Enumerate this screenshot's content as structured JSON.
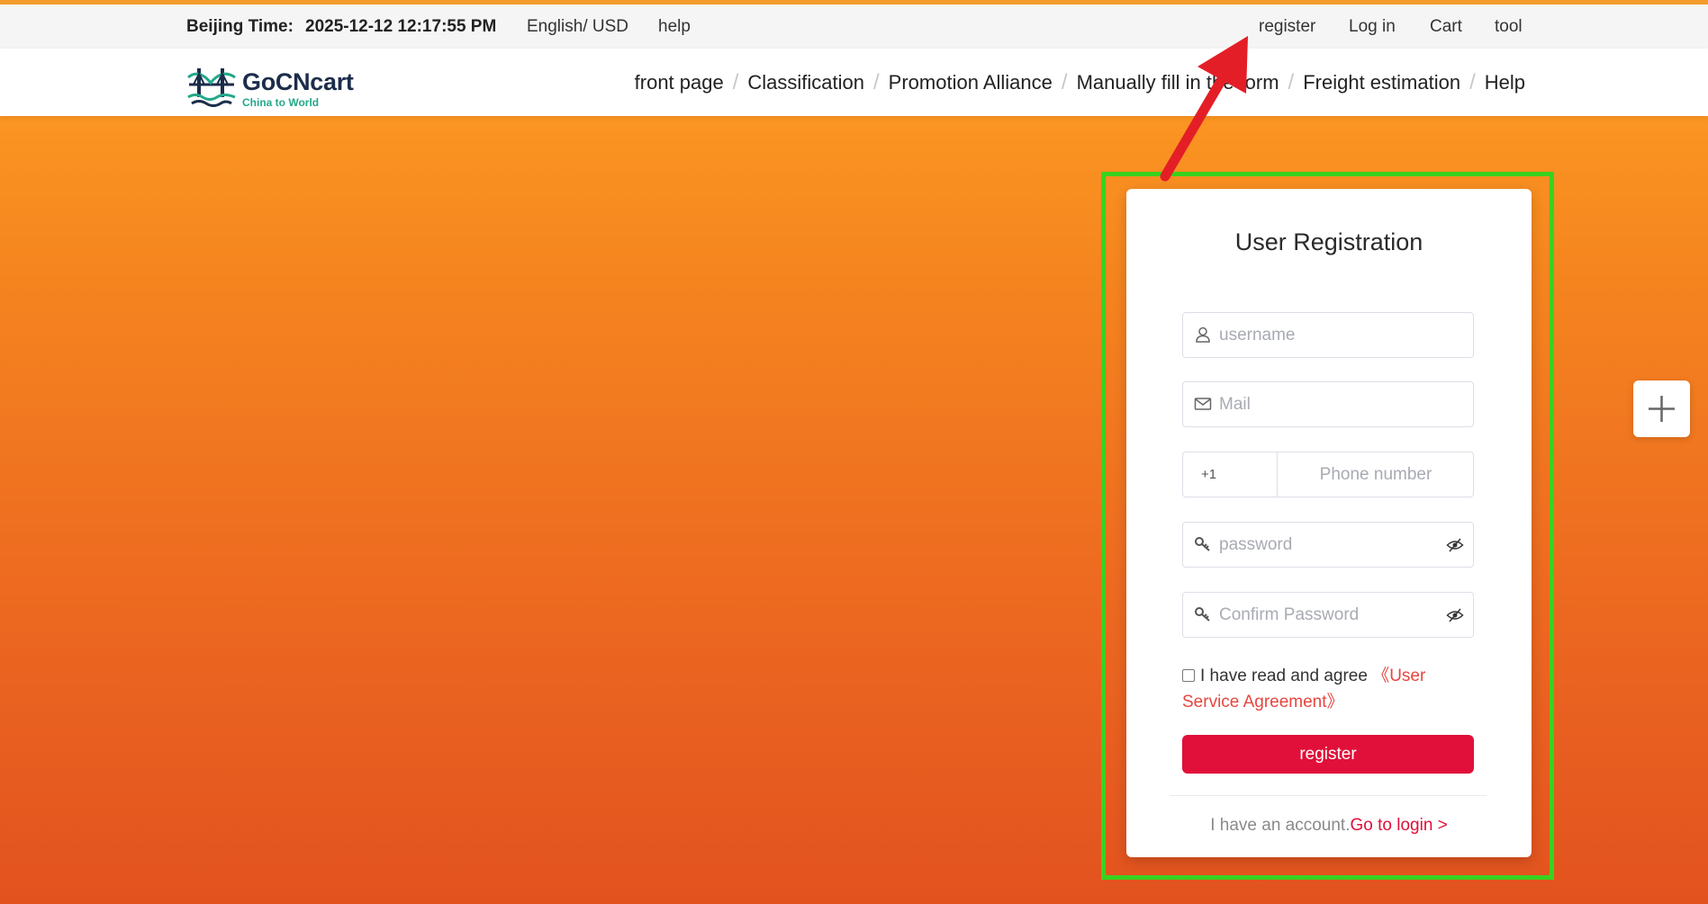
{
  "colors": {
    "accent": "#e0103a",
    "frame": "#39d21f",
    "link": "#e6463f",
    "arrow": "#e41e26"
  },
  "topbar": {
    "time_label": "Beijing Time:",
    "time_value": "2025-12-12 12:17:55 PM",
    "language": "English/ USD",
    "help": "help",
    "register": "register",
    "login": "Log in",
    "cart": "Cart",
    "tool": "tool"
  },
  "logo": {
    "name": "GoCNcart",
    "tagline": "China to World"
  },
  "nav": {
    "items": [
      "front page",
      "Classification",
      "Promotion Alliance",
      "Manually fill in the form",
      "Freight estimation",
      "Help"
    ],
    "separator": "/"
  },
  "form": {
    "title": "User Registration",
    "username_placeholder": "username",
    "mail_placeholder": "Mail",
    "phone_code": "+1",
    "phone_placeholder": "Phone number",
    "password_placeholder": "password",
    "confirm_placeholder": "Confirm Password",
    "agree_text": "I have read and agree",
    "agreement_link": "《User Service Agreement》",
    "register_button": "register",
    "have_account": "I have an account.",
    "login_link": "Go to login >"
  },
  "icons": {
    "username": "user-icon",
    "mail": "mail-icon",
    "password": "key-icon",
    "eye": "eye-off-icon",
    "float": "plus-icon"
  }
}
